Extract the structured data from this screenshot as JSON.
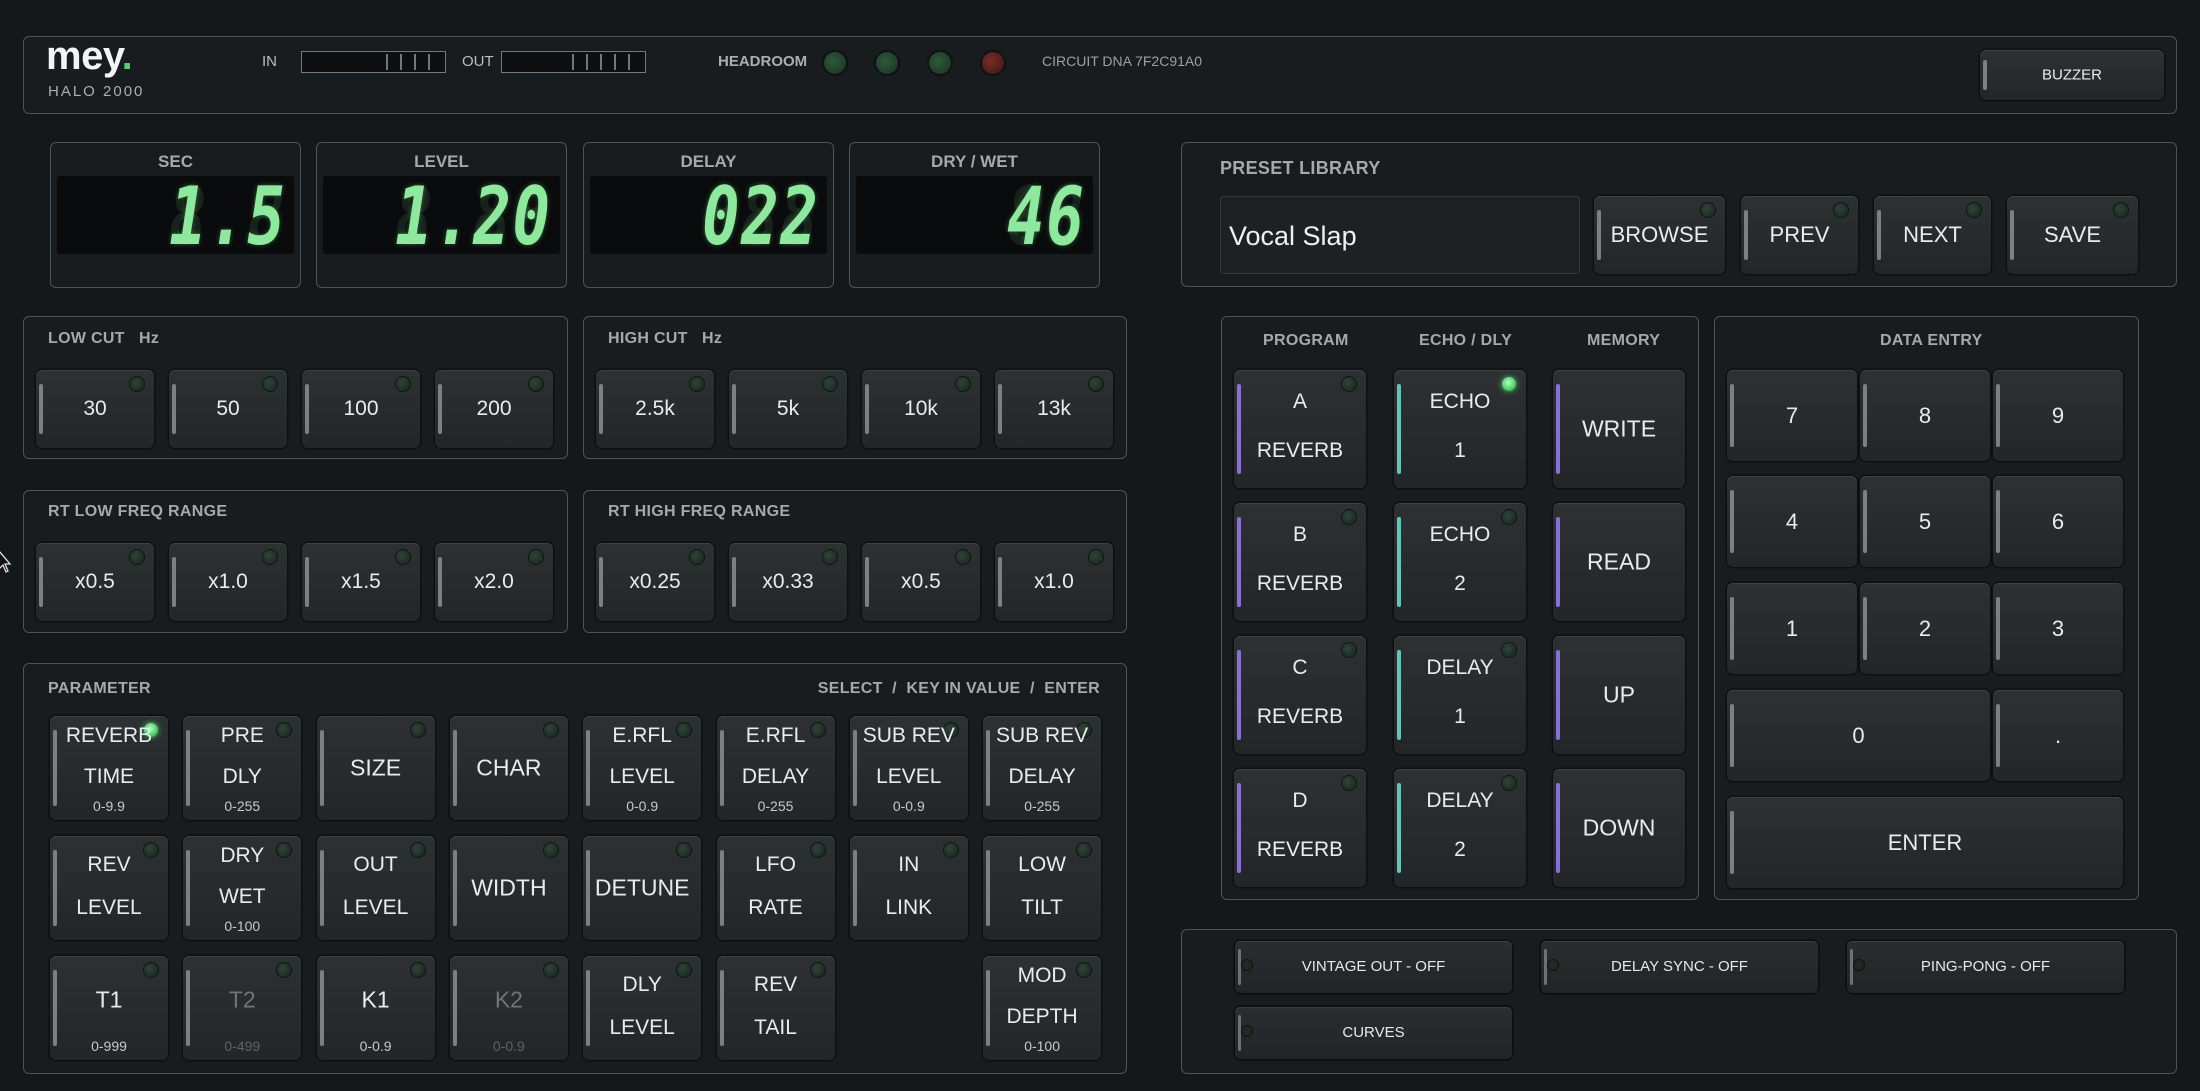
{
  "header": {
    "brand": "mey",
    "model": "HALO 2000",
    "in_label": "IN",
    "out_label": "OUT",
    "headroom_label": "HEADROOM",
    "circuit": "CIRCUIT DNA 7F2C91A0",
    "buzzer": "BUZZER",
    "headroom_leds": [
      "#1f3a26",
      "#1f3a26",
      "#1f3a26",
      "#4a1f1c"
    ],
    "accent": "#4fd36d"
  },
  "displays": [
    {
      "title": "SEC",
      "value": "1.5",
      "ghost": "8.8"
    },
    {
      "title": "LEVEL",
      "value": "1.20",
      "ghost": "8.88"
    },
    {
      "title": "DELAY",
      "value": "022",
      "ghost": "888"
    },
    {
      "title": "DRY / WET",
      "value": "46",
      "ghost": "88"
    }
  ],
  "preset": {
    "title": "PRESET LIBRARY",
    "name": "Vocal Slap",
    "browse": "BROWSE",
    "prev": "PREV",
    "next": "NEXT",
    "save": "SAVE"
  },
  "filters": {
    "low_cut": {
      "title": "LOW CUT",
      "unit": "Hz",
      "options": [
        "30",
        "50",
        "100",
        "200"
      ]
    },
    "high_cut": {
      "title": "HIGH CUT",
      "unit": "Hz",
      "options": [
        "2.5k",
        "5k",
        "10k",
        "13k"
      ]
    },
    "rt_low": {
      "title": "RT LOW FREQ RANGE",
      "options": [
        "x0.5",
        "x1.0",
        "x1.5",
        "x2.0"
      ]
    },
    "rt_high": {
      "title": "RT HIGH FREQ RANGE",
      "options": [
        "x0.25",
        "x0.33",
        "x0.5",
        "x1.0"
      ]
    }
  },
  "parameter": {
    "title": "PARAMETER",
    "hint": "SELECT  /  KEY IN VALUE  /  ENTER",
    "row1": [
      {
        "l1": "REVERB",
        "l2": "TIME",
        "range": "0-9.9",
        "active": true
      },
      {
        "l1": "PRE",
        "l2": "DLY",
        "range": "0-255"
      },
      {
        "label": "SIZE"
      },
      {
        "label": "CHAR"
      },
      {
        "l1": "E.RFL",
        "l2": "LEVEL",
        "range": "0-0.9"
      },
      {
        "l1": "E.RFL",
        "l2": "DELAY",
        "range": "0-255"
      },
      {
        "l1": "SUB REV",
        "l2": "LEVEL",
        "range": "0-0.9"
      },
      {
        "l1": "SUB REV",
        "l2": "DELAY",
        "range": "0-255"
      }
    ],
    "row2": [
      {
        "l1": "REV",
        "l2": "LEVEL"
      },
      {
        "l1": "DRY",
        "l2": "WET",
        "range": "0-100"
      },
      {
        "l1": "OUT",
        "l2": "LEVEL"
      },
      {
        "label": "WIDTH"
      },
      {
        "label": "DETUNE"
      },
      {
        "l1": "LFO",
        "l2": "RATE"
      },
      {
        "l1": "IN",
        "l2": "LINK"
      },
      {
        "l1": "LOW",
        "l2": "TILT"
      }
    ],
    "row3": [
      {
        "label": "T1",
        "range": "0-999"
      },
      {
        "label": "T2",
        "range": "0-499",
        "dim": true
      },
      {
        "label": "K1",
        "range": "0-0.9"
      },
      {
        "label": "K2",
        "range": "0-0.9",
        "dim": true
      },
      {
        "l1": "DLY",
        "l2": "LEVEL"
      },
      {
        "l1": "REV",
        "l2": "TAIL"
      },
      {
        "l1": "MOD",
        "l2": "DEPTH",
        "range": "0-100"
      }
    ]
  },
  "program": {
    "program_header": "PROGRAM",
    "echo_header": "ECHO / DLY",
    "memory_header": "MEMORY",
    "programs": [
      {
        "l1": "A",
        "l2": "REVERB"
      },
      {
        "l1": "B",
        "l2": "REVERB"
      },
      {
        "l1": "C",
        "l2": "REVERB"
      },
      {
        "l1": "D",
        "l2": "REVERB"
      }
    ],
    "echoes": [
      {
        "l1": "ECHO",
        "l2": "1",
        "active": true
      },
      {
        "l1": "ECHO",
        "l2": "2"
      },
      {
        "l1": "DELAY",
        "l2": "1"
      },
      {
        "l1": "DELAY",
        "l2": "2"
      }
    ],
    "memory": [
      "WRITE",
      "READ",
      "UP",
      "DOWN"
    ],
    "program_color": "#8a6fd8",
    "echo_color": "#5fc7b4"
  },
  "keypad": {
    "title": "DATA ENTRY",
    "keys": [
      "7",
      "8",
      "9",
      "4",
      "5",
      "6",
      "1",
      "2",
      "3",
      "0",
      ".",
      "ENTER"
    ]
  },
  "toggles": [
    "VINTAGE OUT - OFF",
    "DELAY SYNC - OFF",
    "PING-PONG - OFF",
    "CURVES"
  ]
}
